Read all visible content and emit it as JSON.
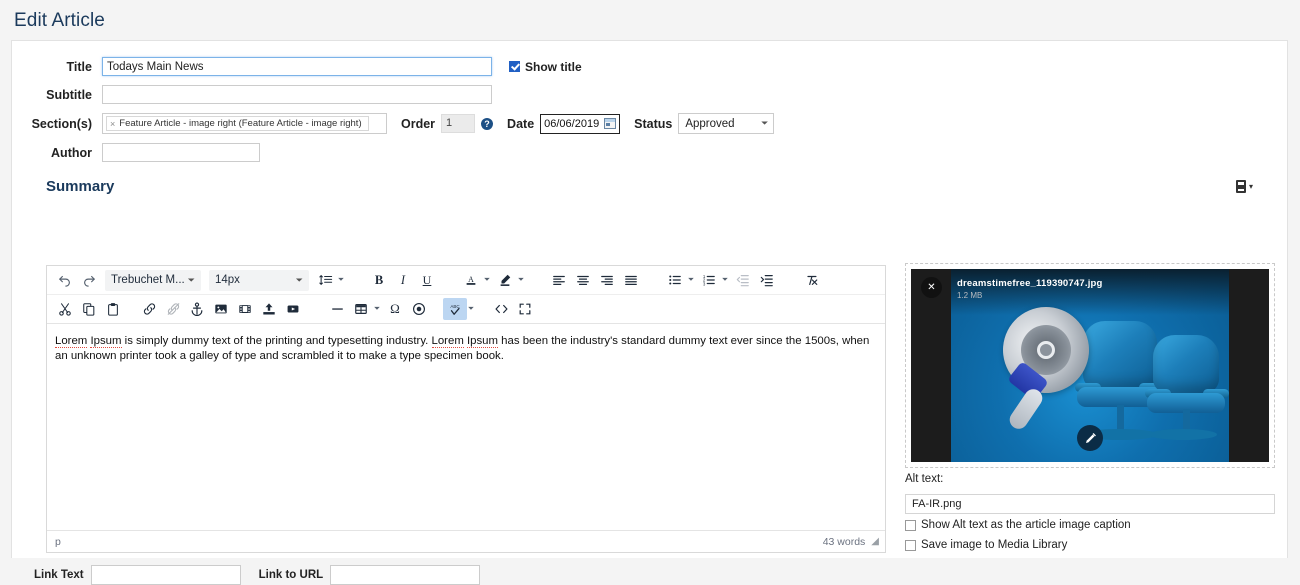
{
  "page": {
    "title": "Edit Article"
  },
  "form": {
    "title_label": "Title",
    "title_value": "Todays Main News",
    "show_title_label": "Show title",
    "show_title_checked": true,
    "subtitle_label": "Subtitle",
    "subtitle_value": "",
    "sections_label": "Section(s)",
    "section_chip": "Feature Article - image right (Feature Article - image right)",
    "section_chip_remove": "×",
    "order_label": "Order",
    "order_value": "1",
    "help_glyph": "?",
    "date_label": "Date",
    "date_value": "06/06/2019",
    "status_label": "Status",
    "status_value": "Approved",
    "author_label": "Author",
    "author_value": ""
  },
  "summary": {
    "heading": "Summary",
    "media_menu_caret": "▾"
  },
  "editor": {
    "font_family": "Trebuchet M...",
    "font_size": "14px",
    "content_paragraph_1": "Lorem Ipsum is simply dummy text of the printing and typesetting industry. Lorem Ipsum has been the industry's standard dummy text ever since the 1500s, when an unknown printer took a galley of type and scrambled it to make a type specimen book.",
    "misspelled_1": "Lorem",
    "misspelled_2": "Ipsum",
    "rest_1": " is simply dummy text of the printing and typesetting industry. ",
    "misspelled_3": "Lorem",
    "misspelled_4": "Ipsum",
    "rest_2": " has been the industry's standard dummy text ever since the 1500s, when an unknown printer took a galley of type and scrambled it to make a type specimen book.",
    "path_indicator": "p",
    "word_count": "43 words",
    "toolbar_row1": [
      "undo-icon",
      "redo-icon",
      "font-family-select",
      "font-size-select",
      "line-height-icon",
      "bold-icon",
      "italic-icon",
      "underline-icon",
      "font-color-icon",
      "highlight-color-icon",
      "align-left-icon",
      "align-center-icon",
      "align-right-icon",
      "align-justify-icon",
      "bullet-list-icon",
      "numbered-list-icon",
      "outdent-icon",
      "indent-icon",
      "clear-formatting-icon"
    ],
    "toolbar_row2": [
      "cut-icon",
      "copy-icon",
      "paste-icon",
      "link-icon",
      "unlink-icon",
      "anchor-icon",
      "image-icon",
      "video-icon",
      "upload-icon",
      "youtube-icon",
      "horizontal-rule-icon",
      "table-icon",
      "special-character-icon",
      "record-icon",
      "spellcheck-icon",
      "source-code-icon",
      "fullscreen-icon"
    ]
  },
  "links": {
    "link_text_label": "Link Text",
    "link_text_value": "",
    "link_url_label": "Link to URL",
    "link_url_value": ""
  },
  "image": {
    "file_name": "dreamstimefree_119390747.jpg",
    "file_size": "1.2 MB",
    "close_glyph": "✕",
    "edit_glyph": "✎",
    "alt_text_label": "Alt text:",
    "alt_text_value": "FA-IR.png",
    "caption_checkbox_label": "Show Alt text as the article image caption",
    "caption_checked": false,
    "media_library_checkbox_label": "Save image to Media Library",
    "media_library_checked": false
  },
  "colors": {
    "heading": "#1b3a5c",
    "accent_blue": "#2160c4",
    "panel_bg": "#ffffff",
    "page_bg": "#f4f4f4",
    "active_toolbar": "#bcd6f2",
    "spell_underline": "#e04a3f"
  }
}
